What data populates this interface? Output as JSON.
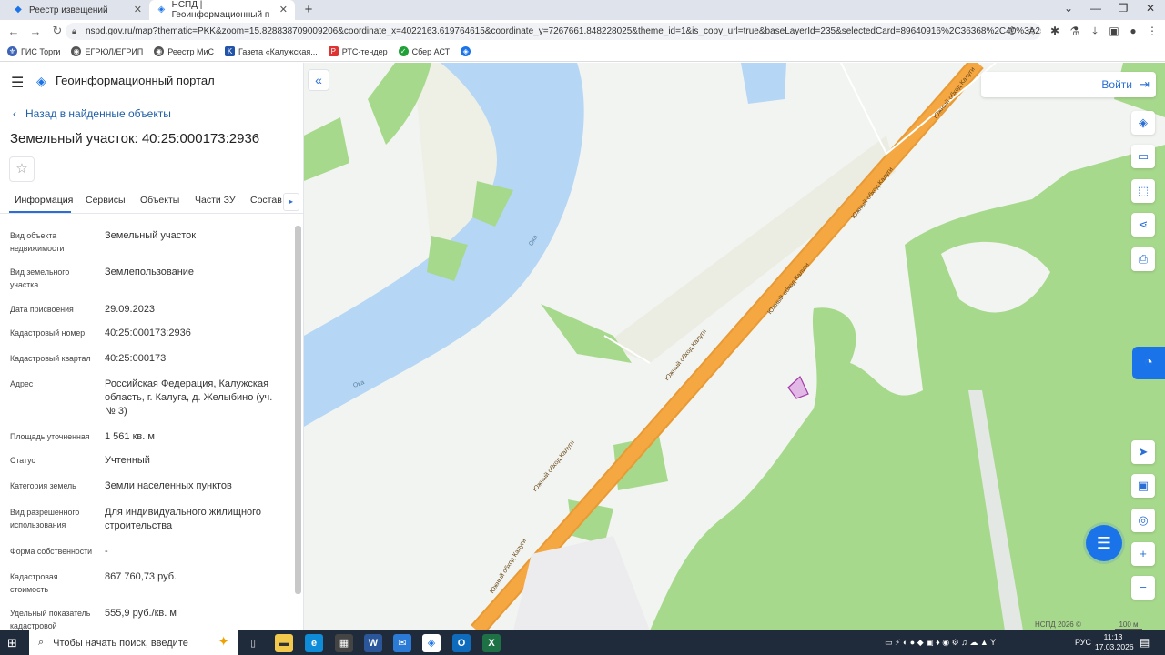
{
  "browser": {
    "tabs": [
      {
        "title": "Реестр извещений",
        "active": false
      },
      {
        "title": "НСПД | Геоинформационный п",
        "active": true
      }
    ],
    "url": "nspd.gov.ru/map?thematic=PKK&zoom=15.828838709009206&coordinate_x=4022163.619764615&coordinate_y=7267661.848228025&theme_id=1&is_copy_url=true&baseLayerId=235&selectedCard=89640916%2C36368%2C40%3A25%3A0...",
    "bookmarks": [
      "ГИС Торги",
      "ЕГРЮЛ/ЕГРИП",
      "Реестр МиС",
      "Газета «Калужская...",
      "РТС-тендер",
      "Сбер АСТ"
    ]
  },
  "panel": {
    "portal_title": "Геоинформационный портал",
    "back_label": "Назад в найденные объекты",
    "object_title": "Земельный участок: 40:25:000173:2936",
    "tabs": [
      "Информация",
      "Сервисы",
      "Объекты",
      "Части ЗУ",
      "Состав"
    ],
    "properties": [
      {
        "label": "Вид объекта недвижимости",
        "value": "Земельный участок"
      },
      {
        "label": "Вид земельного участка",
        "value": "Землепользование"
      },
      {
        "label": "Дата присвоения",
        "value": "29.09.2023"
      },
      {
        "label": "Кадастровый номер",
        "value": "40:25:000173:2936"
      },
      {
        "label": "Кадастровый квартал",
        "value": "40:25:000173"
      },
      {
        "label": "Адрес",
        "value": "Российская Федерация, Калужская область, г. Калуга, д. Желыбино (уч. № 3)"
      },
      {
        "label": "Площадь уточненная",
        "value": "1 561 кв. м"
      },
      {
        "label": "Статус",
        "value": "Учтенный"
      },
      {
        "label": "Категория земель",
        "value": "Земли населенных пунктов"
      },
      {
        "label": "Вид разрешенного использования",
        "value": "Для индивидуального жилищного строительства"
      },
      {
        "label": "Форма собственности",
        "value": "-"
      },
      {
        "label": "Кадастровая стоимость",
        "value": "867 760,73 руб."
      },
      {
        "label": "Удельный показатель кадастровой",
        "value": "555,9 руб./кв. м"
      }
    ]
  },
  "map": {
    "login_label": "Войти",
    "river_labels": [
      "Ока",
      "Ока"
    ],
    "road_labels": [
      "Южный обход Калуги",
      "Южный обход Калуги",
      "Южный обход Калуги",
      "Южный обход Калуги",
      "Южный обход Калуги",
      "Южный обход Калуги"
    ],
    "copyright": "НСПД 2026 ©",
    "scale_label": "100 м",
    "colors": {
      "river": "#b5d6f5",
      "forest": "#a7d98c",
      "road": "#f5a742",
      "parcel": "#a23ca8"
    }
  },
  "taskbar": {
    "search_placeholder": "Чтобы начать поиск, введите",
    "language": "РУС",
    "time": "11:13",
    "date": "17.03.2026"
  }
}
